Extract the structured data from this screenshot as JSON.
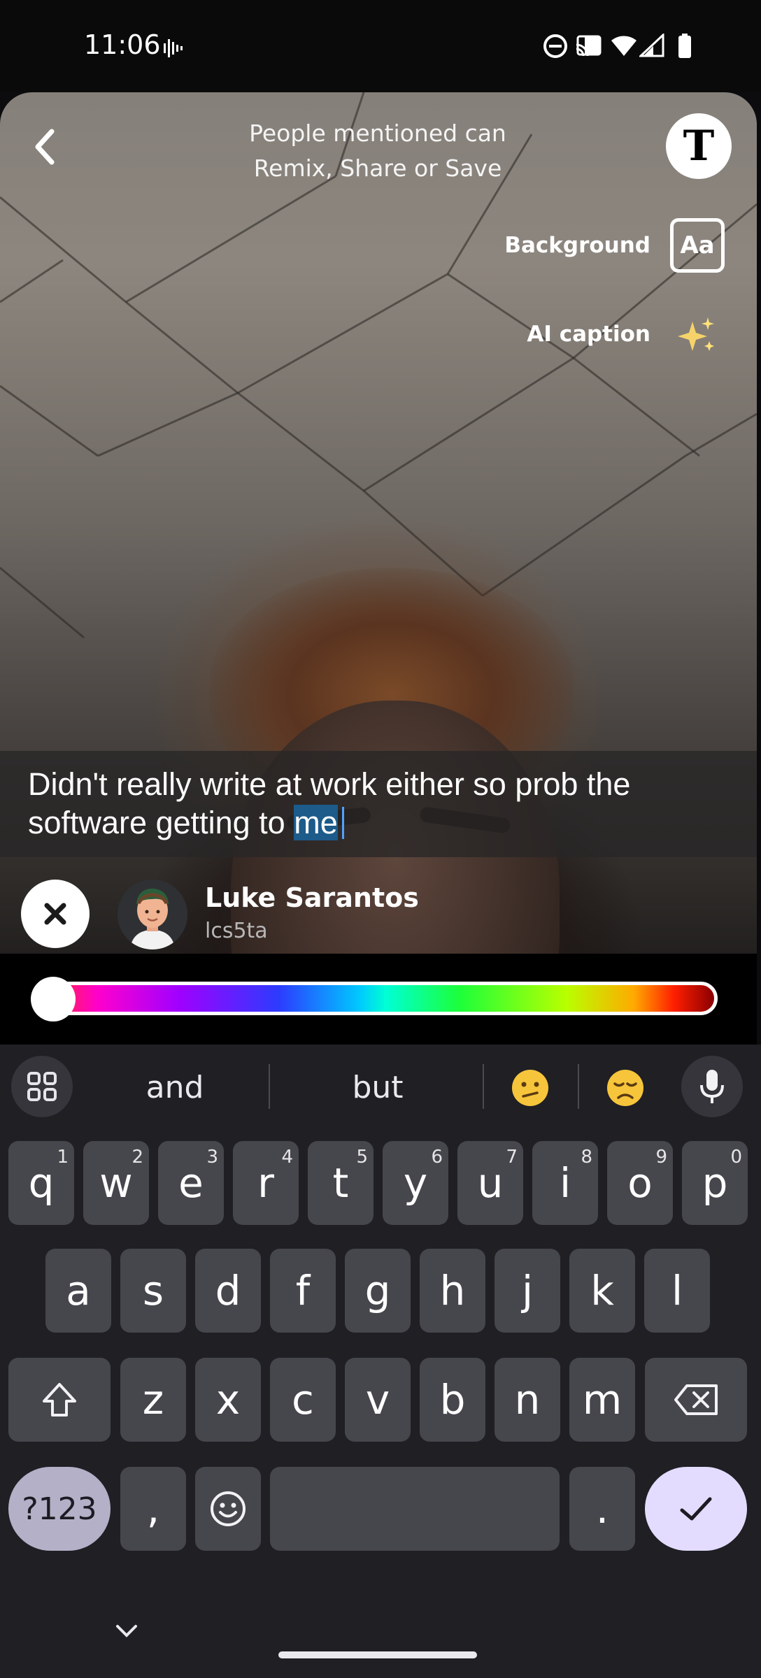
{
  "status_bar": {
    "time": "11:06",
    "icons": [
      "voicemail-wave-icon",
      "do-not-disturb-icon",
      "cast-icon",
      "wifi-icon",
      "signal-icon",
      "battery-icon"
    ]
  },
  "editor": {
    "mention_note_line1": "People mentioned can",
    "mention_note_line2": "Remix, Share or Save",
    "text_tool_glyph": "T",
    "background_label": "Background",
    "background_glyph": "Aa",
    "ai_caption_label": "AI caption",
    "caption_text_before": "Didn't really write at work either so prob the software getting to ",
    "caption_text_selected": "me"
  },
  "mention": {
    "name": "Luke Sarantos",
    "username": "lcs5ta"
  },
  "color_slider": {
    "position": 0.0
  },
  "keyboard": {
    "suggestions": [
      "and",
      "but"
    ],
    "row1": [
      {
        "key": "q",
        "hint": "1"
      },
      {
        "key": "w",
        "hint": "2"
      },
      {
        "key": "e",
        "hint": "3"
      },
      {
        "key": "r",
        "hint": "4"
      },
      {
        "key": "t",
        "hint": "5"
      },
      {
        "key": "y",
        "hint": "6"
      },
      {
        "key": "u",
        "hint": "7"
      },
      {
        "key": "i",
        "hint": "8"
      },
      {
        "key": "o",
        "hint": "9"
      },
      {
        "key": "p",
        "hint": "0"
      }
    ],
    "row2": [
      "a",
      "s",
      "d",
      "f",
      "g",
      "h",
      "j",
      "k",
      "l"
    ],
    "row3": [
      "z",
      "x",
      "c",
      "v",
      "b",
      "n",
      "m"
    ],
    "symbols_label": "?123",
    "comma_label": ",",
    "period_label": ".",
    "accent_color": "#e4dcff"
  }
}
